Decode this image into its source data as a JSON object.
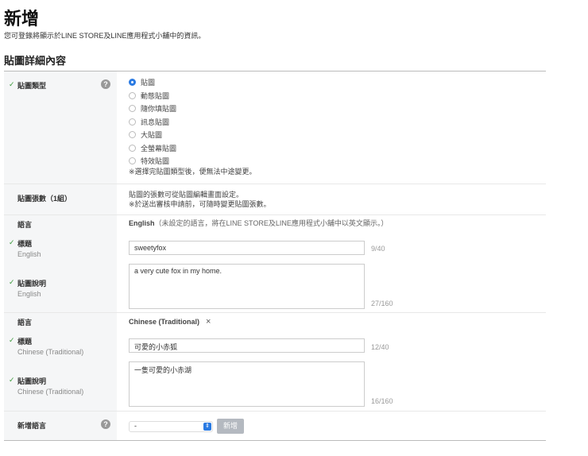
{
  "header": {
    "title": "新增",
    "subtitle": "您可登錄將顯示於LINE STORE及LINE應用程式小舖中的資訊。",
    "section": "貼圖詳細內容"
  },
  "type_row": {
    "label": "貼圖類型",
    "options": [
      "貼圖",
      "動態貼圖",
      "隨你填貼圖",
      "訊息貼圖",
      "大貼圖",
      "全螢幕貼圖",
      "特效貼圖"
    ],
    "selected": 0,
    "note": "※選擇完貼圖類型後，便無法中途變更。"
  },
  "count_row": {
    "label": "貼圖張數（1組）",
    "line1": "貼圖的張數可從貼圖編輯畫面設定。",
    "line2": "※於送出審核申請前，可隨時變更貼圖張數。"
  },
  "english": {
    "lang_label": "語言",
    "lang_name": "English",
    "lang_note": "（未設定的語言，將在LINE STORE及LINE應用程式小舖中以英文顯示。）",
    "title_label": "標題",
    "title_sub": "English",
    "title_value": "sweetyfox",
    "title_count": "9/40",
    "desc_label": "貼圖說明",
    "desc_sub": "English",
    "desc_value": "a very cute fox in my home.",
    "desc_count": "27/160"
  },
  "chinese": {
    "lang_label": "語言",
    "lang_name": "Chinese (Traditional)",
    "remove": "×",
    "title_label": "標題",
    "title_sub": "Chinese (Traditional)",
    "title_value": "可愛的小赤狐",
    "title_count": "12/40",
    "desc_label": "貼圖說明",
    "desc_sub": "Chinese (Traditional)",
    "desc_value": "一隻可愛的小赤湖",
    "desc_count": "16/160"
  },
  "add_lang": {
    "label": "新增語言",
    "select_value": "-",
    "button": "新增"
  },
  "check": "✓",
  "help": "?"
}
